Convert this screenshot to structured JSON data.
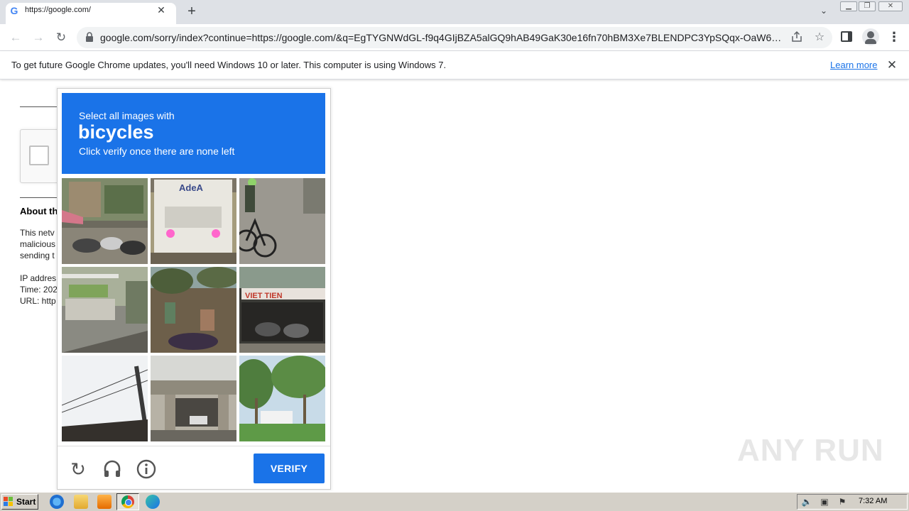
{
  "browser": {
    "tab": {
      "favicon": "G",
      "title": "https://google.com/"
    },
    "url": "google.com/sorry/index?continue=https://google.com/&q=EgTYGNWdGL-f9q4GIjBZA5alGQ9hAB49GaK30e16fn70hBM3Xe7BLENDPC3YpSQqx-OaW6xwL...",
    "icons": {
      "back": "arrow-left-icon",
      "forward": "arrow-right-icon",
      "reload": "reload-icon",
      "lock": "lock-icon",
      "share": "share-icon",
      "bookmark": "star-icon",
      "side_panel": "side-panel-icon",
      "profile": "profile-icon",
      "menu": "kebab-menu-icon"
    }
  },
  "infobar": {
    "message": "To get future Google Chrome updates, you'll need Windows 10 or later. This computer is using Windows 7.",
    "link": "Learn more"
  },
  "page": {
    "about_heading": "About th",
    "lines": [
      "This netv",
      "malicious",
      "sending t",
      "IP addres",
      "Time: 202",
      "URL: http"
    ]
  },
  "challenge": {
    "line1": "Select all images with",
    "keyword": "bicycles",
    "line3": "Click verify once there are none left",
    "tiles": [
      {
        "scene": "street with parked scooters and shop awning"
      },
      {
        "scene": "white truck with ADEA sign and headlights"
      },
      {
        "scene": "cyclist riding on sidewalk"
      },
      {
        "scene": "building entrance with planters and fence"
      },
      {
        "scene": "crowded street with motorbikes"
      },
      {
        "scene": "shop front with VIET TIEN sign"
      },
      {
        "scene": "utility pole against sky"
      },
      {
        "scene": "overpass with parked car"
      },
      {
        "scene": "palm trees with white van"
      }
    ],
    "truck_sign": "AdeA",
    "shop_sign": "VIET TIEN",
    "verify_label": "VERIFY",
    "accent_color": "#1a73e8"
  },
  "watermark": "ANY RUN",
  "taskbar": {
    "start_label": "Start",
    "clock": "7:32 AM"
  }
}
